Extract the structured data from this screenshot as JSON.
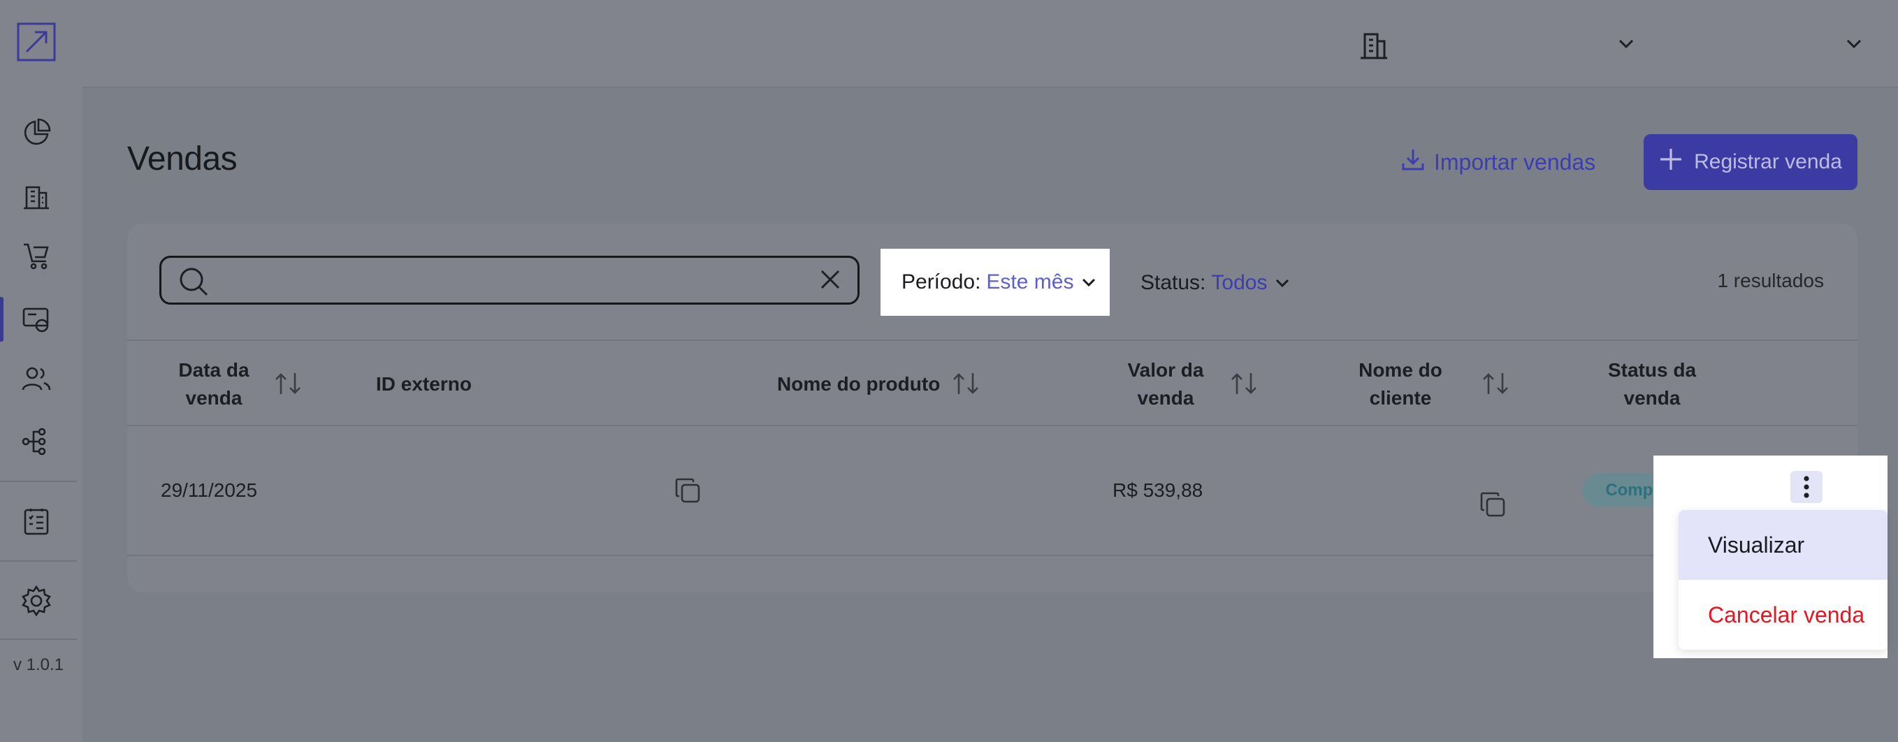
{
  "sidebar": {
    "version": "v 1.0.1"
  },
  "header": {
    "title": "Vendas",
    "import_label": "Importar vendas",
    "register_label": "Registrar venda"
  },
  "filters": {
    "search_value": "",
    "periodo_label": "Período:",
    "periodo_value": "Este mês",
    "status_label": "Status:",
    "status_value": "Todos",
    "results": "1 resultados"
  },
  "table": {
    "columns": {
      "data_venda": [
        "Data da",
        "venda"
      ],
      "id_externo": "ID externo",
      "nome_produto": "Nome do produto",
      "valor_venda": [
        "Valor da",
        "venda"
      ],
      "nome_cliente": [
        "Nome do",
        "cliente"
      ],
      "status_venda": [
        "Status da",
        "venda"
      ]
    },
    "rows": [
      {
        "data": "29/11/2025",
        "id_externo": "",
        "produto": "",
        "valor": "R$ 539,88",
        "cliente": "",
        "status": "Completa"
      }
    ]
  },
  "row_menu": {
    "view_label": "Visualizar",
    "cancel_label": "Cancelar venda"
  },
  "colors": {
    "accent": "#3c3db0",
    "danger": "#e8141f",
    "overlay": "#7b7f88"
  }
}
